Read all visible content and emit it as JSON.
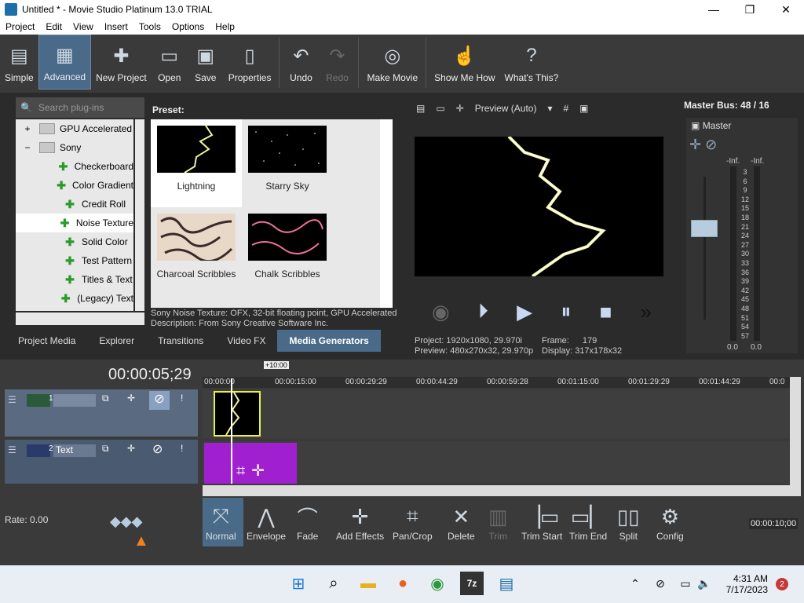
{
  "window": {
    "title": "Untitled * - Movie Studio Platinum 13.0 TRIAL",
    "minimize": "—",
    "maximize": "❐",
    "close": "✕"
  },
  "menu": [
    "Project",
    "Edit",
    "View",
    "Insert",
    "Tools",
    "Options",
    "Help"
  ],
  "toolbar": {
    "simple": "Simple",
    "advanced": "Advanced",
    "new_project": "New Project",
    "open": "Open",
    "save": "Save",
    "properties": "Properties",
    "undo": "Undo",
    "redo": "Redo",
    "make_movie": "Make Movie",
    "show_me_how": "Show Me How",
    "whats_this": "What's This?"
  },
  "plugins": {
    "search_placeholder": "Search plug-ins",
    "tree": [
      {
        "label": "GPU Accelerated",
        "type": "folder",
        "expander": "+"
      },
      {
        "label": "Sony",
        "type": "folder",
        "expander": "−"
      },
      {
        "label": "Checkerboard",
        "type": "plugin"
      },
      {
        "label": "Color Gradient",
        "type": "plugin"
      },
      {
        "label": "Credit Roll",
        "type": "plugin"
      },
      {
        "label": "Noise Texture",
        "type": "plugin",
        "selected": true
      },
      {
        "label": "Solid Color",
        "type": "plugin"
      },
      {
        "label": "Test Pattern",
        "type": "plugin"
      },
      {
        "label": "Titles & Text",
        "type": "plugin"
      },
      {
        "label": "(Legacy) Text",
        "type": "plugin"
      }
    ]
  },
  "presets": {
    "label": "Preset:",
    "items": [
      {
        "name": "Lightning",
        "selected": true
      },
      {
        "name": "Starry Sky"
      },
      {
        "name": "Charcoal Scribbles"
      },
      {
        "name": "Chalk Scribbles"
      }
    ],
    "description_line1": "Sony Noise Texture: OFX, 32-bit floating point, GPU Accelerated",
    "description_line2": "Description: From Sony Creative Software Inc."
  },
  "tabs": [
    "Project Media",
    "Explorer",
    "Transitions",
    "Video FX",
    "Media Generators"
  ],
  "active_tab": "Media Generators",
  "preview": {
    "mode": "Preview (Auto)",
    "project_label": "Project:",
    "project_value": "1920x1080, 29.970i",
    "preview_label": "Preview:",
    "preview_value": "480x270x32, 29.970p",
    "frame_label": "Frame:",
    "frame_value": "179",
    "display_label": "Display:",
    "display_value": "317x178x32"
  },
  "master": {
    "title": "Master Bus: 48 / 16",
    "label": "Master",
    "inf_left": "-Inf.",
    "inf_right": "-Inf.",
    "scale": [
      "3",
      "6",
      "9",
      "12",
      "15",
      "18",
      "21",
      "24",
      "27",
      "30",
      "33",
      "36",
      "39",
      "42",
      "45",
      "48",
      "51",
      "54",
      "57"
    ],
    "bottom_left": "0.0",
    "bottom_right": "0.0"
  },
  "timeline": {
    "timecode": "00:00:05;29",
    "zoom_badge": "+10:00",
    "ruler": [
      "00:00:00",
      "00:00:15:00",
      "00:00:29:29",
      "00:00:44:29",
      "00:00:59:28",
      "00:01:15:00",
      "00:01:29:29",
      "00:01:44:29",
      "00:0"
    ],
    "track1_number": "1",
    "track2_number": "2",
    "track2_name": "Text",
    "rate": "Rate: 0.00",
    "end_time": "00:00:10;00"
  },
  "edit_tools": {
    "normal": "Normal",
    "envelope": "Envelope",
    "fade": "Fade",
    "add_effects": "Add Effects",
    "pan_crop": "Pan/Crop",
    "delete": "Delete",
    "trim": "Trim",
    "trim_start": "Trim Start",
    "trim_end": "Trim End",
    "split": "Split",
    "config": "Config"
  },
  "taskbar": {
    "time": "4:31 AM",
    "date": "7/17/2023",
    "notifications": "2"
  },
  "colors": {
    "accent": "#4a6a8a",
    "text_clip": "#a020d0",
    "lightning": "#e8f080"
  }
}
